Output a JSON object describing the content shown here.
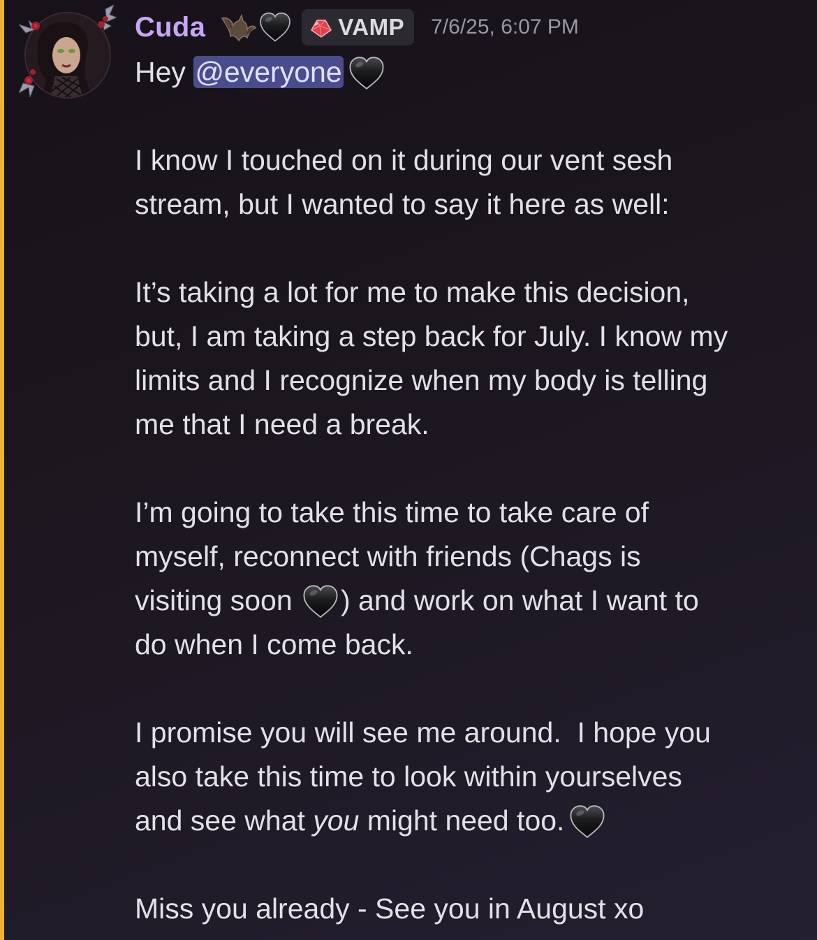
{
  "message": {
    "author": {
      "username": "Cuda",
      "tag_label": "VAMP",
      "name_color": "#c9a6f5",
      "badges": [
        "bat-icon",
        "black-heart-icon"
      ],
      "tag_icon": "red-gem-icon"
    },
    "timestamp": "7/6/25, 6:07 PM",
    "mention_highlight_color": "#f0b232",
    "greeting": {
      "prefix": "Hey ",
      "mention": "@everyone"
    },
    "paragraph1": {
      "line1": "I know I touched on it during our vent sesh",
      "line2": "stream, but I wanted to say it here as well:"
    },
    "paragraph2": {
      "line1": "It’s taking a lot for me to make this decision,",
      "line2": "but, I am taking a step back for July. I know my",
      "line3": "limits and I recognize when my body is telling",
      "line4": "me that I need a break."
    },
    "paragraph3": {
      "line1": "I’m going to take this time to take care of",
      "line2": "myself, reconnect with friends (Chags is",
      "line3_before": "visiting soon ",
      "line3_after": ") and work on what I want to",
      "line4": "do when I come back."
    },
    "paragraph4": {
      "line1": "I promise you will see me around.  I hope you",
      "line2": "also take this time to look within yourselves",
      "line3_before": "and see what ",
      "line3_italic": "you",
      "line3_after": " might need too."
    },
    "signoff": "Miss you already - See you in August xo"
  }
}
